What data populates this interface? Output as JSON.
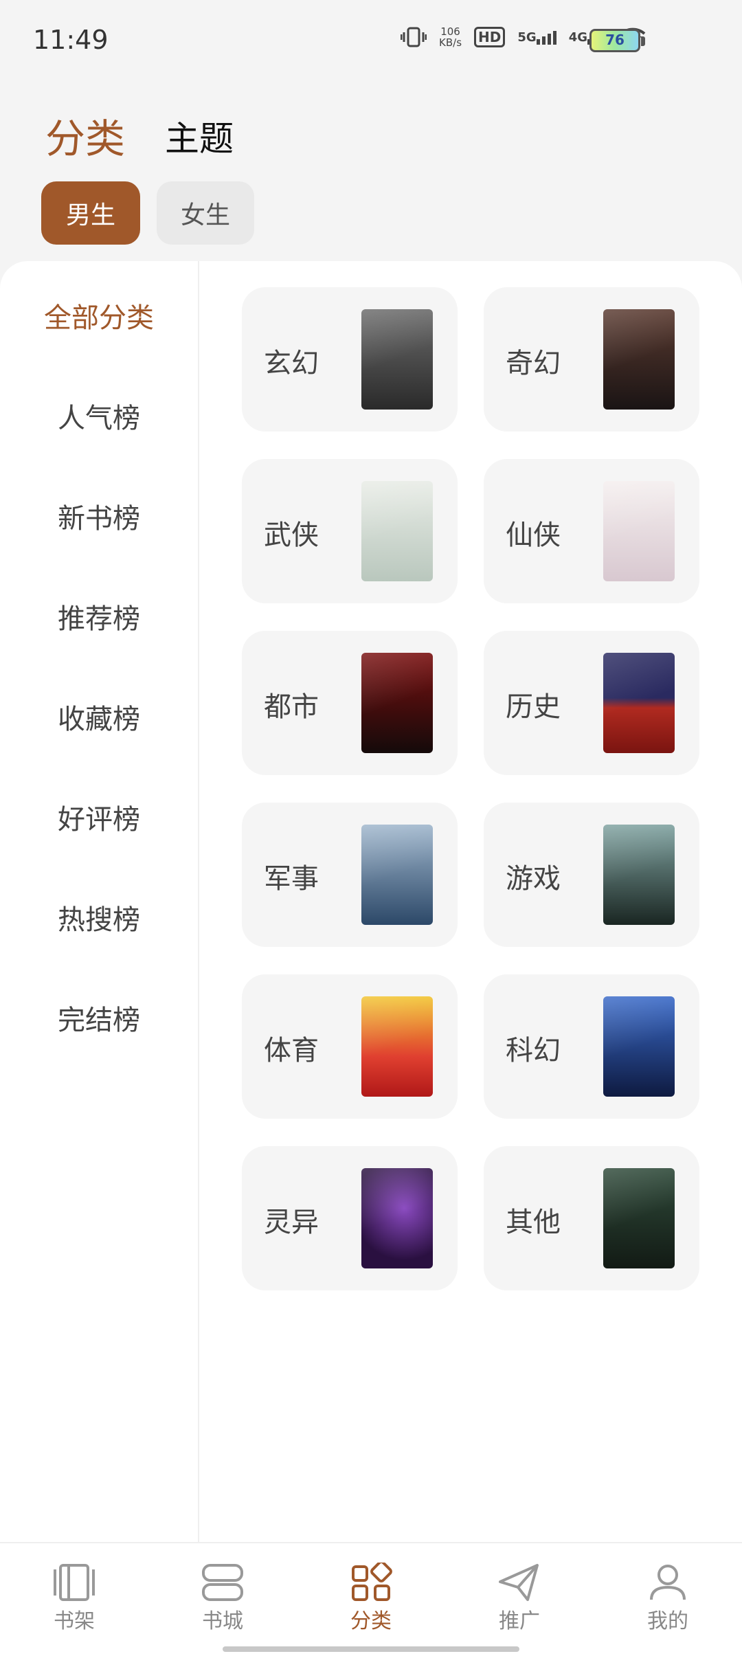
{
  "status_bar": {
    "time": "11:49",
    "speed_value": "106",
    "speed_unit": "KB/s",
    "hd_label": "HD",
    "net1": "5G",
    "net2": "4G",
    "battery": "76"
  },
  "header": {
    "tab_active": "分类",
    "tab_inactive": "主题"
  },
  "gender": {
    "male": "男生",
    "female": "女生"
  },
  "sidebar": {
    "items": [
      {
        "label": "全部分类"
      },
      {
        "label": "人气榜"
      },
      {
        "label": "新书榜"
      },
      {
        "label": "推荐榜"
      },
      {
        "label": "收藏榜"
      },
      {
        "label": "好评榜"
      },
      {
        "label": "热搜榜"
      },
      {
        "label": "完结榜"
      }
    ]
  },
  "categories": [
    {
      "label": "玄幻",
      "cover_color": "#3a3a3a"
    },
    {
      "label": "奇幻",
      "cover_color": "#2b2420"
    },
    {
      "label": "武侠",
      "cover_color": "#cfd6cf"
    },
    {
      "label": "仙侠",
      "cover_color": "#e9e3e3"
    },
    {
      "label": "都市",
      "cover_color": "#1a1010"
    },
    {
      "label": "历史",
      "cover_color": "#8a1f1a"
    },
    {
      "label": "军事",
      "cover_color": "#4a6a88"
    },
    {
      "label": "游戏",
      "cover_color": "#2e3d38"
    },
    {
      "label": "体育",
      "cover_color": "#c8281d"
    },
    {
      "label": "科幻",
      "cover_color": "#1d2e6a"
    },
    {
      "label": "灵异",
      "cover_color": "#2a1640"
    },
    {
      "label": "其他",
      "cover_color": "#1e2a22"
    }
  ],
  "bottom_nav": [
    {
      "label": "书架",
      "icon": "bookshelf-icon"
    },
    {
      "label": "书城",
      "icon": "bookstore-icon"
    },
    {
      "label": "分类",
      "icon": "category-icon"
    },
    {
      "label": "推广",
      "icon": "send-icon"
    },
    {
      "label": "我的",
      "icon": "profile-icon"
    }
  ],
  "colors": {
    "accent": "#a0582a",
    "card_bg": "#f5f5f5"
  }
}
